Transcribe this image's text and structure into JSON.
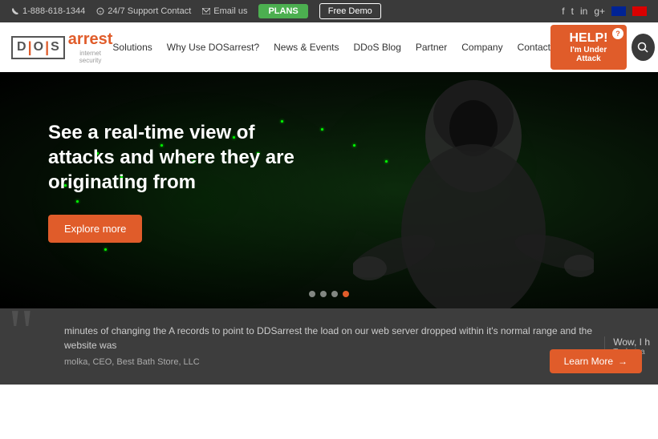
{
  "topbar": {
    "phone": "1-888-618-1344",
    "support": "24/7 Support Contact",
    "email": "Email us",
    "plans_label": "PLANS",
    "free_demo_label": "Free Demo"
  },
  "social": {
    "facebook": "f",
    "twitter": "in",
    "linkedin": "in",
    "googleplus": "g+"
  },
  "nav": {
    "logo_d": "D",
    "logo_o": "O",
    "logo_s": "S",
    "logo_arrest": "arrest",
    "logo_subtitle": "internet security",
    "links": [
      {
        "label": "Solutions",
        "href": "#"
      },
      {
        "label": "Why Use DOSarrest?",
        "href": "#"
      },
      {
        "label": "News & Events",
        "href": "#"
      },
      {
        "label": "DDoS Blog",
        "href": "#"
      },
      {
        "label": "Partner",
        "href": "#"
      },
      {
        "label": "Company",
        "href": "#"
      },
      {
        "label": "Contact",
        "href": "#"
      }
    ],
    "help_main": "HELP!",
    "help_sub": "I'm Under Attack"
  },
  "hero": {
    "headline": "See a real-time view of attacks and where they are originating from",
    "cta_label": "Explore more",
    "dots": [
      {
        "active": true
      },
      {
        "active": false
      },
      {
        "active": false
      },
      {
        "active": false
      }
    ]
  },
  "testimonial": {
    "quote_icon": "“",
    "text": "minutes of changing the A records to point to DDSarrest the load on our web server dropped within it's normal range and the website was",
    "author": "molka, CEO, Best Bath Store, LLC",
    "right_text": "Wow, I h",
    "right_sub": "Technica",
    "learn_more": "Learn More"
  }
}
